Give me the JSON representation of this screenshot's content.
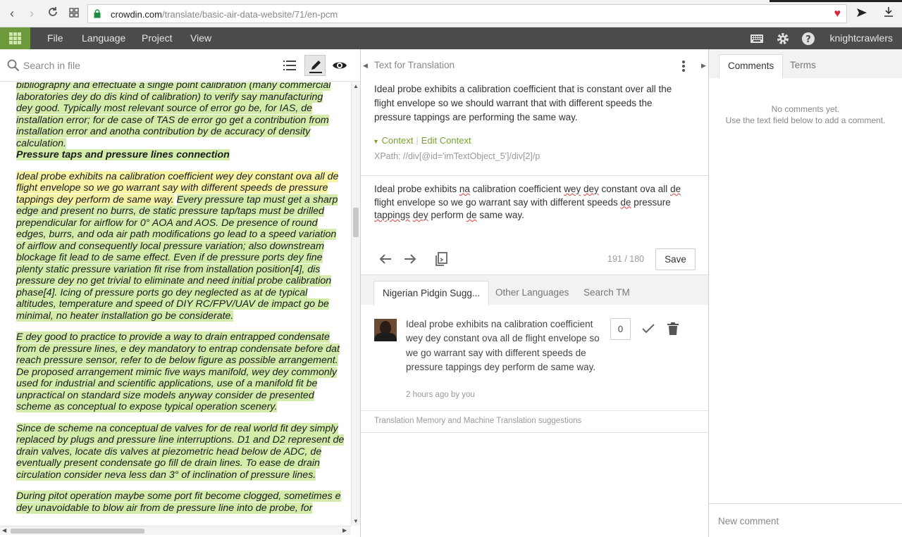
{
  "browser": {
    "url_domain": "crowdin.com",
    "url_path": "/translate/basic-air-data-website/71/en-pcm"
  },
  "header": {
    "menu": [
      "File",
      "Language",
      "Project",
      "View"
    ],
    "username": "knightcrawlers"
  },
  "left": {
    "search_placeholder": "Search in file",
    "doc": {
      "p1_lines": [
        "bibliography and effectuate a single point calibration (many commercial",
        "laboratories dey do dis kind of calibration) to verify say manufacturing",
        "dey good. Typically most relevant source of error go be, for IAS, de",
        "installation error; for de case of TAS de error go get a contribution from",
        "installation error and anotha contribution by de accuracy of density",
        "calculation."
      ],
      "heading": "Pressure taps and pressure lines connection",
      "p2_highlight": "Ideal probe exhibits na calibration coefficient wey dey constant ova all de flight envelope so we go warrant say with different speeds de pressure tappings dey perform de same way.",
      "p2_rest": "Every pressure tap must get a sharp edge and present no burrs, de static pressure tap/taps must be drilled prependicular for airflow for 0° AOA and AOS. De presence of round edges, burrs, and oda air path modifications go lead to a speed variation of airflow and consequently local pressure variation; also downstream blockage fit lead to de same effect. Even if de pressure ports dey fine plenty static pressure variation fit rise from installation position[4], dis pressure dey no get trivial to eliminate and need initial probe calibration phase[4]. Icing of pressure ports go dey neglected as at de typical altitudes, temperature and speed of DIY RC/FPV/UAV de impact go be minimal, no heater installation go be considerate.",
      "p3": "E dey good to practice to provide a way to drain entrapped condensate from de pressure lines, e dey mandatory to entrap condensate before dat reach pressure sensor, refer to de below figure as possible arrangement. De proposed arrangement mimic five ways manifold, wey dey commonly used for industrial and scientific applications, use of a manifold fit be unpractical on standard size models anyway consider de presented scheme as conceptual to expose typical operation scenery.",
      "p4": "Since de scheme na conceptual de valves for de real world fit dey simply replaced by plugs and pressure line interruptions. D1 and D2 represent de drain valves, locate dis valves at piezometric head below de ADC, de eventually present condensate go fill de drain lines. To ease de drain circulation consider neva less dan 3° of inclination of pressure lines.",
      "p5": "During pitot operation maybe some port fit become clogged, sometimes e dey unavoidable to blow air from de pressure line into de probe, for"
    }
  },
  "middle": {
    "title": "Text for Translation",
    "source_text": "Ideal probe exhibits a calibration coefficient that is constant over all the flight envelope so we should warrant that with different speeds the pressure tappings are performing the same way.",
    "context_label": "Context",
    "edit_context_label": "Edit Context",
    "xpath": "XPath: //div[@id='imTextObject_5']/div[2]/p",
    "translation": [
      {
        "t": "Ideal probe exhibits ",
        "s": false
      },
      {
        "t": "na",
        "s": true
      },
      {
        "t": " calibration coefficient ",
        "s": false
      },
      {
        "t": "wey",
        "s": true
      },
      {
        "t": " ",
        "s": false
      },
      {
        "t": "dey",
        "s": true
      },
      {
        "t": " constant ova all ",
        "s": false
      },
      {
        "t": "de",
        "s": true
      },
      {
        "t": " flight envelope so we go warrant say with different speeds ",
        "s": false
      },
      {
        "t": "de",
        "s": true
      },
      {
        "t": " pressure ",
        "s": false
      },
      {
        "t": "tappings",
        "s": true
      },
      {
        "t": " ",
        "s": false
      },
      {
        "t": "dey",
        "s": true
      },
      {
        "t": " perform ",
        "s": false
      },
      {
        "t": "de",
        "s": true
      },
      {
        "t": " same way.",
        "s": false
      }
    ],
    "counter": "191 / 180",
    "save_label": "Save",
    "tabs": [
      "Nigerian Pidgin Sugg...",
      "Other Languages",
      "Search TM"
    ],
    "suggestion": {
      "text": "Ideal probe exhibits na calibration coefficient wey dey constant ova all de flight envelope so we go warrant say with different speeds de pressure tappings dey perform de same way.",
      "meta": "2 hours ago by you",
      "votes": "0"
    },
    "tm_label": "Translation Memory and Machine Translation suggestions"
  },
  "right": {
    "tabs": [
      "Comments",
      "Terms"
    ],
    "no_comments_line1": "No comments yet.",
    "no_comments_line2": "Use the text field below to add a comment.",
    "new_comment_placeholder": "New comment"
  },
  "colors": {
    "accent_green": "#6e9a3b",
    "translated_bg": "#d3ecaa",
    "current_bg": "#f6f3a4",
    "header_bg": "#4b4b4b"
  }
}
